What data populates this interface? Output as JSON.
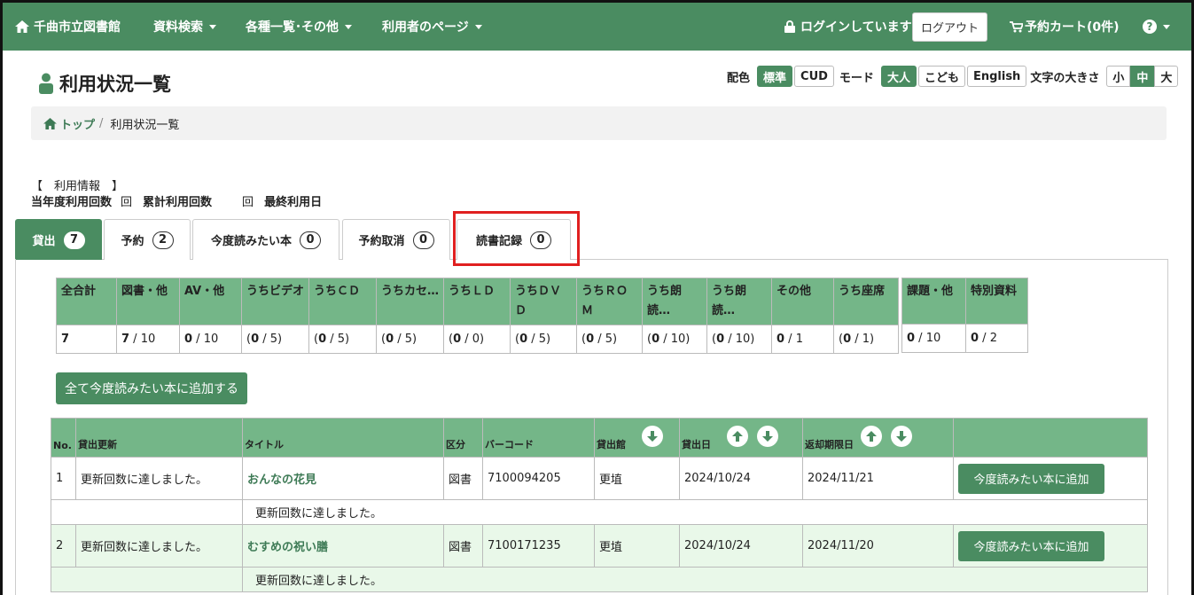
{
  "nav": {
    "home": "千曲市立図書館",
    "search": "資料検索",
    "lists": "各種一覧･その他",
    "user_page": "利用者のページ",
    "login_status": "ログインしています",
    "logout": "ログアウト",
    "cart": "予約カート(0件)"
  },
  "header": {
    "title": "利用状況一覧",
    "color_label": "配色",
    "color_standard": "標準",
    "color_cud": "CUD",
    "mode_label": "モード",
    "mode_adult": "大人",
    "mode_kids": "こども",
    "english": "English",
    "size_label": "文字の大きさ",
    "size_small": "小",
    "size_medium": "中",
    "size_large": "大"
  },
  "breadcrumb": {
    "top": "トップ",
    "sep": "/",
    "current": "利用状況一覧"
  },
  "usage": {
    "heading": "【　利用情報　】",
    "year_count": "当年度利用回数",
    "mark": "回",
    "total_count": "累計利用回数",
    "mark2": "回",
    "last_date": "最終利用日"
  },
  "tabs": [
    {
      "label": "貸出",
      "count": "7"
    },
    {
      "label": "予約",
      "count": "2"
    },
    {
      "label": "今度読みたい本",
      "count": "0"
    },
    {
      "label": "予約取消",
      "count": "0"
    },
    {
      "label": "読書記録",
      "count": "0"
    }
  ],
  "summary": {
    "headers": [
      "全合計",
      "図書・他",
      "AV・他",
      "うちビデオ",
      "うちＣＤ",
      "うちカセ…",
      "うちＬＤ",
      "うちＤＶＤ",
      "うちＲＯＭ",
      "うち朗読…",
      "うち朗読…",
      "その他",
      "うち座席"
    ],
    "values": [
      {
        "b": "7",
        "r": ""
      },
      {
        "b": "7",
        "r": " / 10"
      },
      {
        "b": "0",
        "r": " / 10"
      },
      {
        "p": "(",
        "b": "0",
        "r": " / 5)"
      },
      {
        "p": "(",
        "b": "0",
        "r": " / 5)"
      },
      {
        "p": "(",
        "b": "0",
        "r": " / 5)"
      },
      {
        "p": "(",
        "b": "0",
        "r": " / 0)"
      },
      {
        "p": "(",
        "b": "0",
        "r": " / 5)"
      },
      {
        "p": "(",
        "b": "0",
        "r": " / 5)"
      },
      {
        "p": "(",
        "b": "0",
        "r": " / 10)"
      },
      {
        "p": "(",
        "b": "0",
        "r": " / 10)"
      },
      {
        "b": "0",
        "r": " / 1"
      },
      {
        "p": "(",
        "b": "0",
        "r": " / 1)"
      }
    ],
    "headers2": [
      "課題・他",
      "特別資料"
    ],
    "values2": [
      {
        "b": "0",
        "r": " / 10"
      },
      {
        "b": "0",
        "r": " / 2"
      }
    ]
  },
  "add_all_button": "全て今度読みたい本に追加する",
  "loans": {
    "columns": [
      "No.",
      "貸出更新",
      "タイトル",
      "区分",
      "バーコード",
      "貸出館",
      "貸出日",
      "返却期限日"
    ],
    "add_label": "今度読みたい本に追加",
    "rows": [
      {
        "no": "1",
        "renew": "更新回数に達しました。",
        "title": "おんなの花見",
        "type": "図書",
        "barcode": "7100094205",
        "library": "更埴",
        "loan_date": "2024/10/24",
        "due_date": "2024/11/21",
        "note": "更新回数に達しました。"
      },
      {
        "no": "2",
        "renew": "更新回数に達しました。",
        "title": "むすめの祝い膳",
        "type": "図書",
        "barcode": "7100171235",
        "library": "更埴",
        "loan_date": "2024/10/24",
        "due_date": "2024/11/20",
        "note": "更新回数に達しました。"
      }
    ]
  },
  "colors": {
    "brand": "#4a8c61",
    "header_cell": "#74b688",
    "highlight": "#e02020",
    "row_alt": "#e9f8e9"
  }
}
